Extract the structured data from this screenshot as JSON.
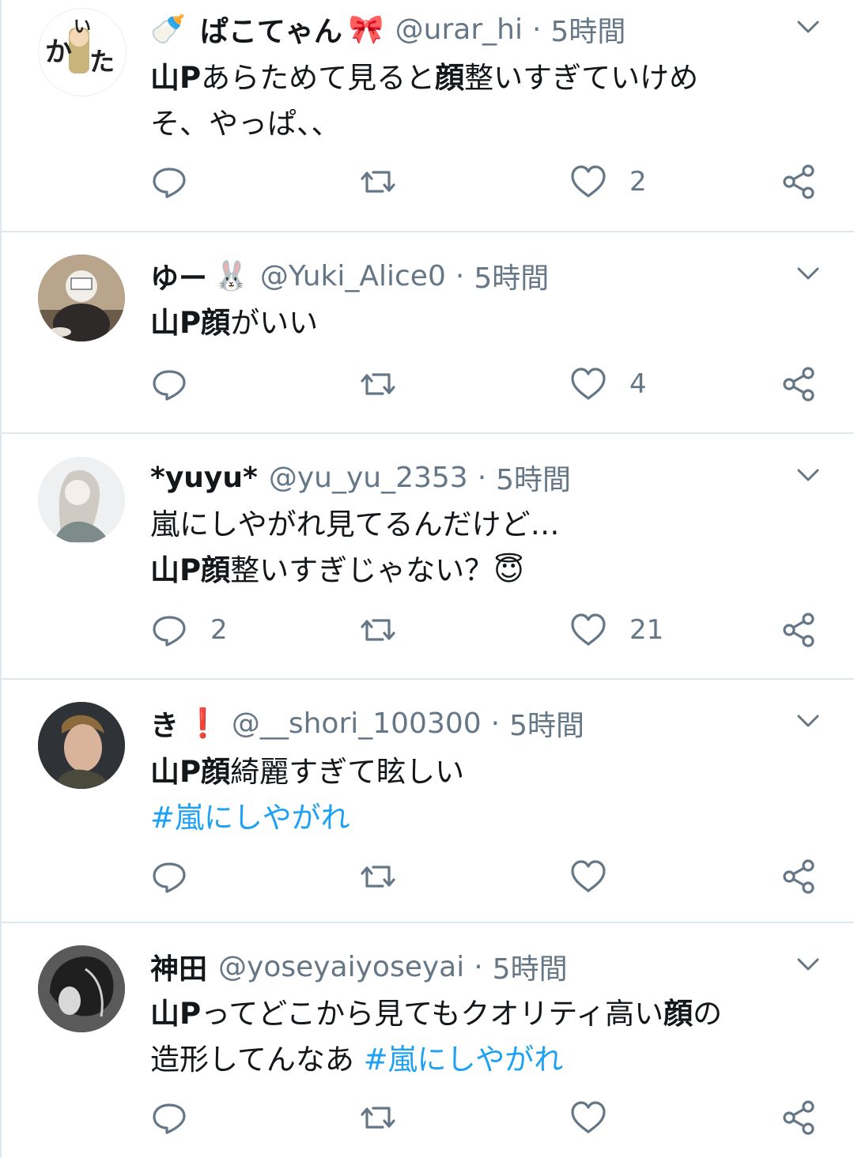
{
  "tweets": [
    {
      "name": "ぱこてゃん",
      "name_prefix_emoji": "🍼",
      "name_emoji": "🎀",
      "handle": "@urar_hi",
      "time": "5時間",
      "avatar_text": "かいた",
      "body": [
        {
          "t": "山P",
          "b": true
        },
        {
          "t": "あらためて見ると"
        },
        {
          "t": "顔",
          "b": true
        },
        {
          "t": "整いすぎていけめ"
        },
        {
          "br": true
        },
        {
          "t": "そ、やっぱ、、"
        }
      ],
      "replies": "",
      "retweets": "",
      "likes": "2"
    },
    {
      "name": "ゆー",
      "name_emoji": "🐰",
      "handle": "@Yuki_Alice0",
      "time": "5時間",
      "body": [
        {
          "t": "山P顔",
          "b": true
        },
        {
          "t": "がいい"
        }
      ],
      "replies": "",
      "retweets": "",
      "likes": "4"
    },
    {
      "name": "*yuyu*",
      "name_emoji": "",
      "handle": "@yu_yu_2353",
      "time": "5時間",
      "body": [
        {
          "t": "嵐にしやがれ見てるんだけど…"
        },
        {
          "br": true
        },
        {
          "t": "山P顔",
          "b": true
        },
        {
          "t": "整いすぎじゃない？"
        },
        {
          "t": "😇",
          "emoji": true
        }
      ],
      "replies": "2",
      "retweets": "",
      "likes": "21"
    },
    {
      "name": "き",
      "name_emoji": "❗",
      "handle": "@__shori_100300",
      "time": "5時間",
      "body": [
        {
          "t": "山P顔",
          "b": true
        },
        {
          "t": "綺麗すぎて眩しい"
        },
        {
          "br": true
        },
        {
          "t": "#嵐にしやがれ",
          "tag": true
        }
      ],
      "replies": "",
      "retweets": "",
      "likes": ""
    },
    {
      "name": "神田",
      "name_emoji": "",
      "handle": "@yoseyaiyoseyai",
      "time": "5時間",
      "body": [
        {
          "t": "山P",
          "b": true
        },
        {
          "t": "ってどこから見てもクオリティ高い"
        },
        {
          "t": "顔",
          "b": true
        },
        {
          "t": "の"
        },
        {
          "br": true
        },
        {
          "t": "造形してんなあ "
        },
        {
          "t": "#嵐にしやがれ",
          "tag": true
        }
      ],
      "replies": "",
      "retweets": "",
      "likes": ""
    }
  ],
  "colors": {
    "text": "#14171a",
    "secondary": "#657786",
    "hashtag": "#1da1f2",
    "divider": "#e1e8ed"
  },
  "icons": [
    "reply-icon",
    "retweet-icon",
    "like-icon",
    "share-icon",
    "chevron-down-icon"
  ]
}
